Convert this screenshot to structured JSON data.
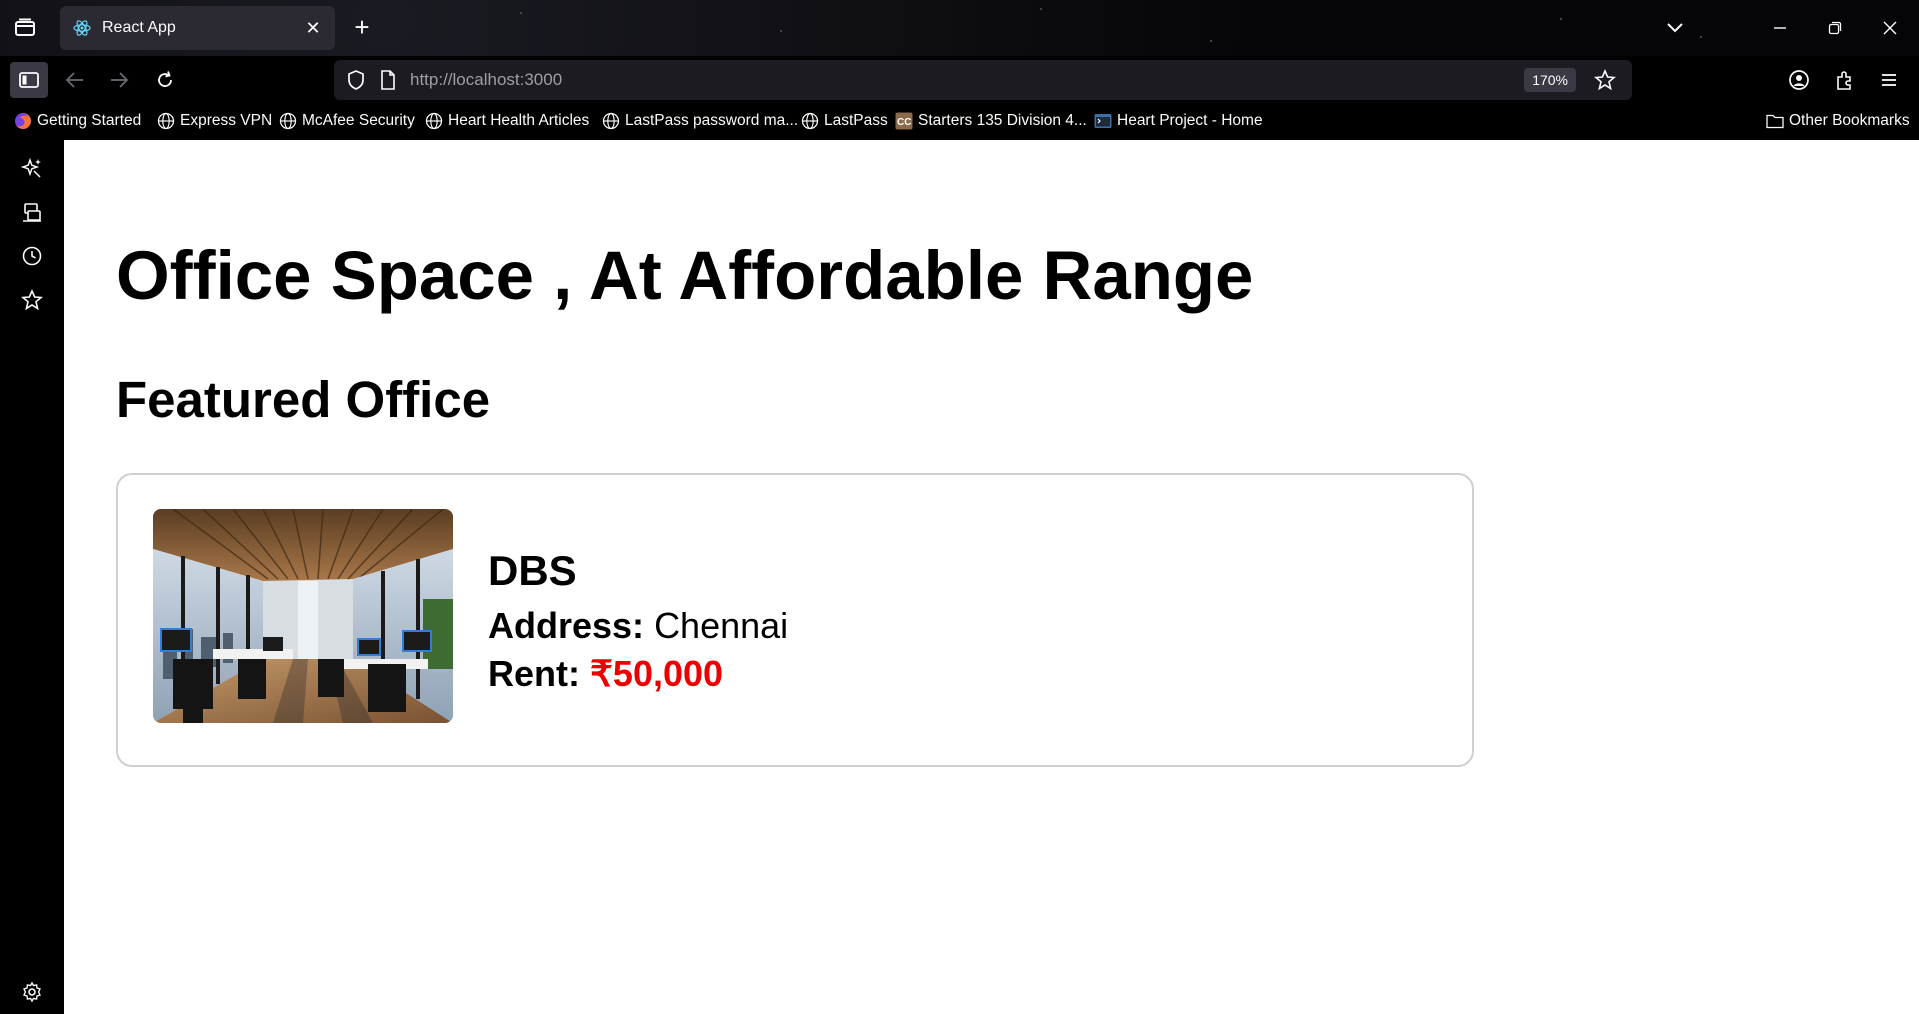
{
  "browser": {
    "tab": {
      "title": "React App"
    },
    "url": {
      "scheme_host": "http://localhost",
      "port": ":3000"
    },
    "zoom": "170%",
    "bookmarks": [
      {
        "label": "Getting Started",
        "icon": "firefox-icon"
      },
      {
        "label": "Express VPN",
        "icon": "globe-icon"
      },
      {
        "label": "McAfee Security",
        "icon": "globe-icon"
      },
      {
        "label": "Heart Health Articles",
        "icon": "globe-icon"
      },
      {
        "label": "LastPass password ma...",
        "icon": "globe-icon"
      },
      {
        "label": "LastPass",
        "icon": "globe-icon"
      },
      {
        "label": "Starters 135 Division 4...",
        "icon": "codechef-icon"
      },
      {
        "label": "Heart Project - Home",
        "icon": "terminal-icon"
      }
    ],
    "other_bookmarks": "Other Bookmarks"
  },
  "page": {
    "heading": "Office Space , At Affordable Range",
    "subheading": "Featured Office",
    "office": {
      "name": "DBS",
      "address_label": "Address:",
      "address": "Chennai",
      "rent_label": "Rent:",
      "rent": "₹50,000"
    }
  },
  "colors": {
    "rent": "#ee0000",
    "card_border": "#cfcfcf"
  }
}
